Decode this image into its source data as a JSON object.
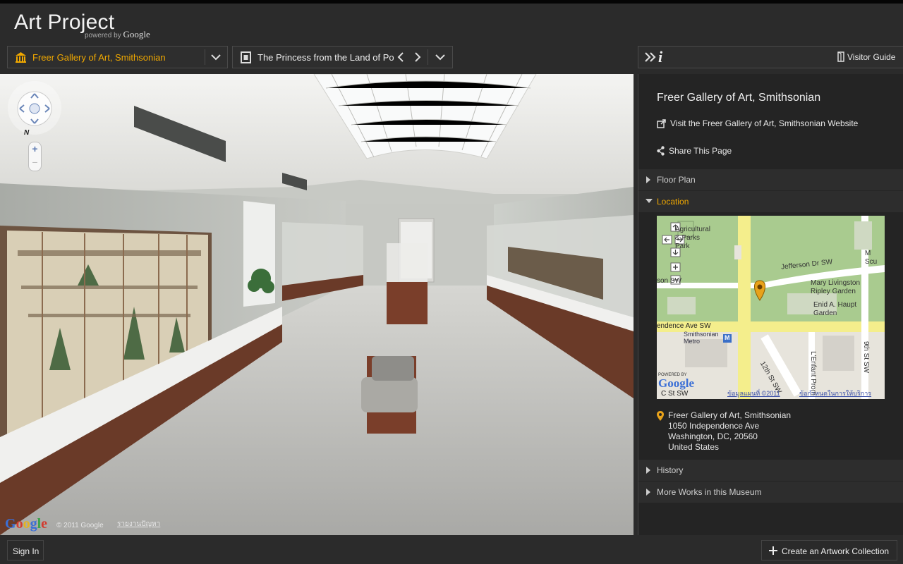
{
  "app": {
    "title": "Art Project",
    "powered_prefix": "powered by",
    "powered_brand": "Google"
  },
  "museum_select": {
    "value": "Freer Gallery of Art, Smithsonian",
    "icon": "museum-icon",
    "accent": "#f0a800"
  },
  "artwork_select": {
    "value": "The Princess from the Land of Porc",
    "icon": "artwork-frame-icon"
  },
  "right_toolbar": {
    "visitor_guide": "Visitor Guide"
  },
  "viewer": {
    "brand": "Google",
    "copyright": "© 2011 Google",
    "report": "รายงานปัญหา",
    "compass_north": "N",
    "zoom_in": "+",
    "zoom_out": "−"
  },
  "info_panel": {
    "title": "Freer Gallery of Art, Smithsonian",
    "website_link": "Visit the Freer Gallery of Art, Smithsonian Website",
    "share_link": "Share This Page",
    "sections": {
      "floor_plan": "Floor Plan",
      "location": "Location",
      "history": "History",
      "more_works": "More Works in this Museum"
    },
    "map": {
      "labels": {
        "park": "Agricultural & Parks Park",
        "jefferson": "Jefferson Dr SW",
        "son": "son SW",
        "ripley": "Mary Livingston Ripley Garden",
        "haupt": "Enid A. Haupt Garden",
        "independence": "endence Ave SW",
        "metro": "Smithsonian Metro",
        "metro_m": "M",
        "twelfth": "12th St SW",
        "lenfant": "L'Enfant Prom",
        "ninth": "9th St SW",
        "c_st": "C St SW",
        "scu": "M Scu",
        "powered": "POWERED BY",
        "brand": "Google",
        "data": "ข้อมูลแผนที่ ©2011",
        "terms": "ข้อกำหนดในการให้บริการ"
      }
    },
    "address": {
      "name": "Freer Gallery of Art, Smithsonian",
      "street": "1050 Independence Ave",
      "city": "Washington, DC, 20560",
      "country": "United States"
    }
  },
  "bottom": {
    "sign_in": "Sign In",
    "create_collection": "Create an Artwork Collection"
  }
}
